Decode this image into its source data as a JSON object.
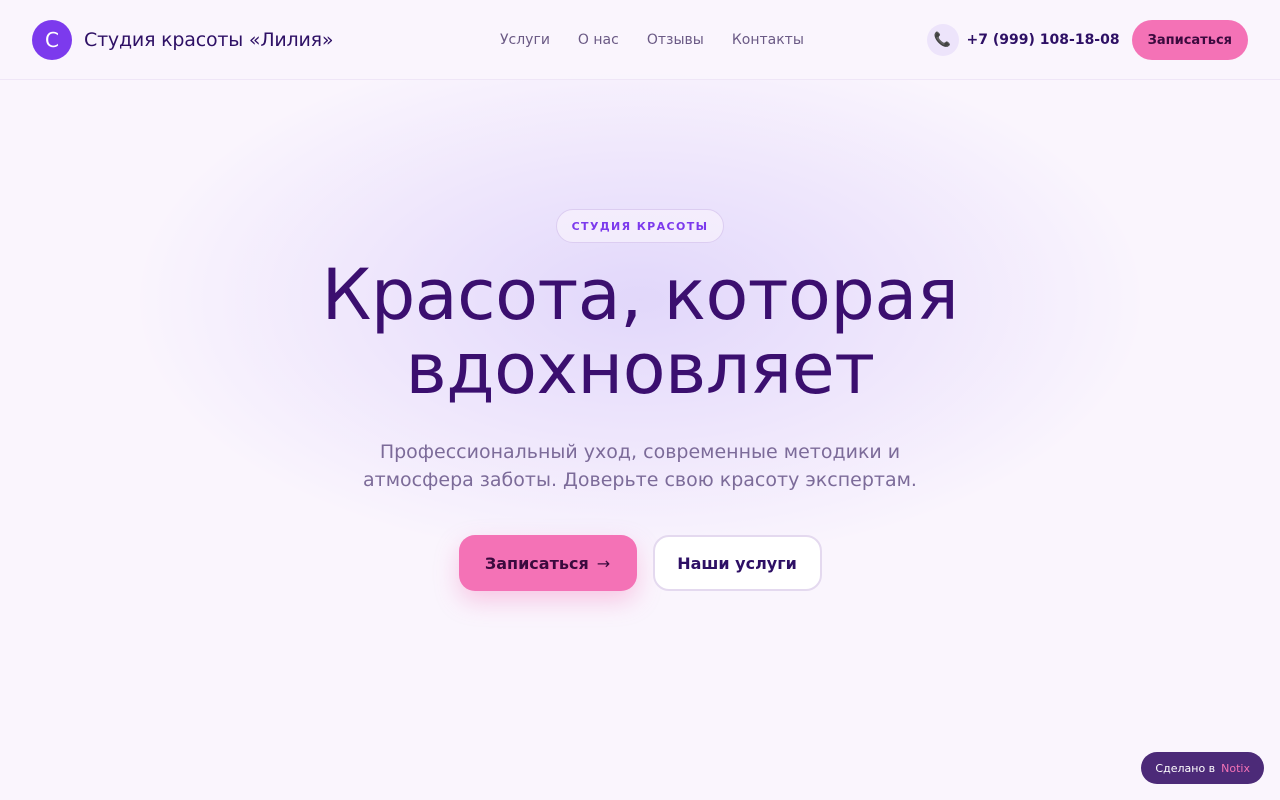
{
  "header": {
    "logo_letter": "С",
    "brand_name": "Студия красоты «Лилия»",
    "nav": [
      "Услуги",
      "О нас",
      "Отзывы",
      "Контакты"
    ],
    "phone_icon": "phone-icon",
    "phone": "+7 (999) 108-18-08",
    "cta_label": "Записаться"
  },
  "hero": {
    "badge": "СТУДИЯ КРАСОТЫ",
    "title_line1": "Красота, которая",
    "title_line2": "вдохновляет",
    "subtitle": "Профессиональный уход, современные методики и атмосфера заботы. Доверьте свою красоту экспертам.",
    "primary_label": "Записаться",
    "primary_arrow": "→",
    "secondary_label": "Наши услуги"
  },
  "footer_badge": {
    "prefix": "Сделано в",
    "brand": "Notix"
  },
  "colors": {
    "accent": "#7c3aed",
    "pink": "#f472b6",
    "title": "#3b0f6f",
    "background": "#faf5fd"
  }
}
